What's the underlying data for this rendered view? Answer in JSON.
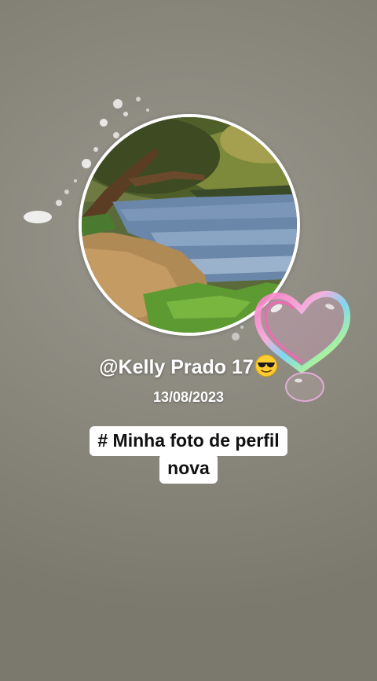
{
  "profile": {
    "username": "@Kelly Prado 17",
    "emoji": "sunglasses-emoji",
    "date": "13/08/2023"
  },
  "caption": {
    "line1": "# Minha foto de perfil",
    "line2": "nova"
  },
  "colors": {
    "background": "#8c8a7f",
    "avatar_border": "#ffffff",
    "caption_bg": "#ffffff",
    "caption_text": "#111111",
    "text": "#ffffff"
  }
}
